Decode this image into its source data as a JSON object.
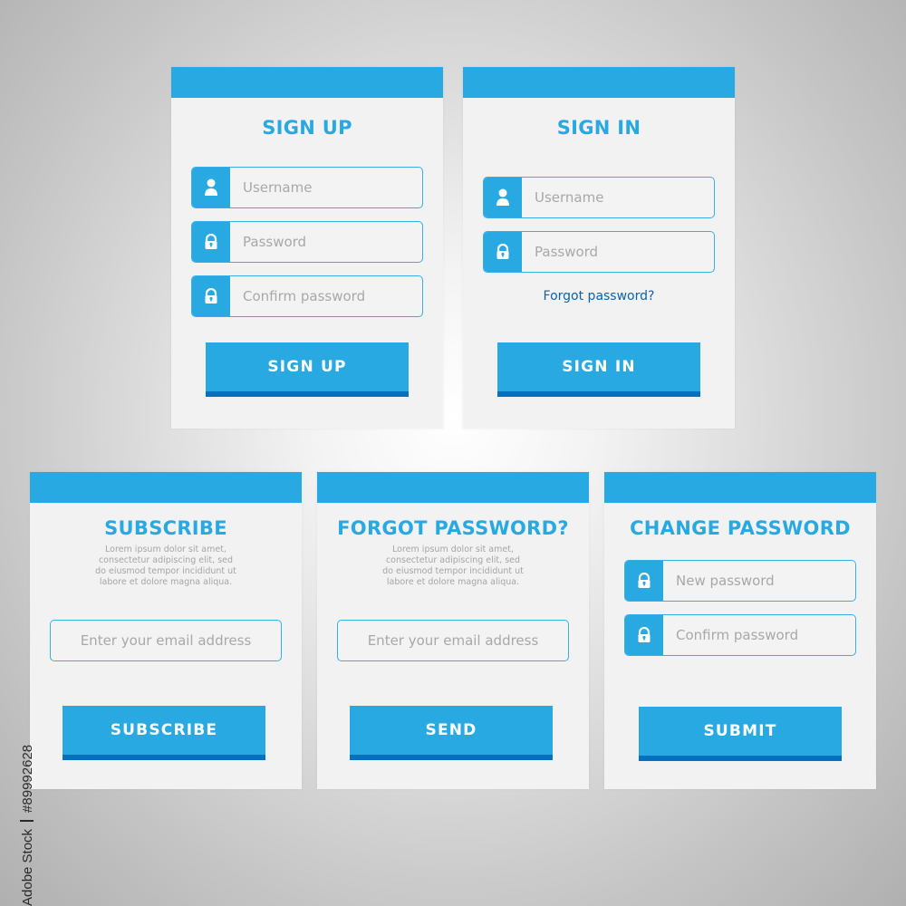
{
  "colors": {
    "accent": "#29a9e2",
    "button_bottom": "#0470c0",
    "link": "#0a63ad",
    "placeholder": "#a8a8a8",
    "panel_bg": "#f2f2f2"
  },
  "signup": {
    "title": "SIGN UP",
    "fields": [
      {
        "icon": "user-icon",
        "placeholder": "Username"
      },
      {
        "icon": "lock-icon",
        "placeholder": "Password"
      },
      {
        "icon": "lock-icon",
        "placeholder": "Confirm password"
      }
    ],
    "button": "SIGN UP"
  },
  "signin": {
    "title": "SIGN IN",
    "fields": [
      {
        "icon": "user-icon",
        "placeholder": "Username"
      },
      {
        "icon": "lock-icon",
        "placeholder": "Password"
      }
    ],
    "forgot_link": "Forgot password?",
    "button": "SIGN IN"
  },
  "subscribe": {
    "title": "SUBSCRIBE",
    "description": [
      "Lorem ipsum dolor sit amet,",
      "consectetur adipiscing elit, sed",
      "do eiusmod tempor incididunt ut",
      "labore et dolore magna aliqua."
    ],
    "email_placeholder": "Enter your email address",
    "button": "SUBSCRIBE"
  },
  "forgot": {
    "title": "FORGOT PASSWORD?",
    "description": [
      "Lorem ipsum dolor sit amet,",
      "consectetur adipiscing elit, sed",
      "do eiusmod tempor incididunt ut",
      "labore et dolore magna aliqua."
    ],
    "email_placeholder": "Enter your email address",
    "button": "SEND"
  },
  "change": {
    "title": "CHANGE PASSWORD",
    "fields": [
      {
        "icon": "lock-icon",
        "placeholder": "New password"
      },
      {
        "icon": "lock-icon",
        "placeholder": "Confirm password"
      }
    ],
    "button": "SUBMIT"
  },
  "credit": {
    "brand": "Adobe Stock",
    "id": "#89992628"
  }
}
